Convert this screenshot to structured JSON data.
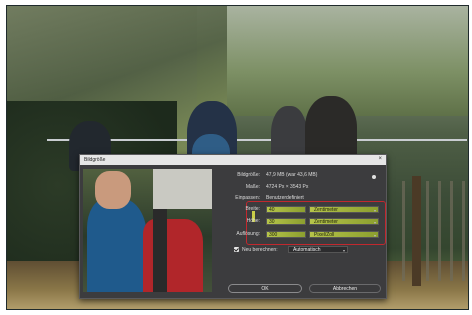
{
  "dialog": {
    "title": "Bildgröße",
    "close_glyph": "×",
    "info_rows": [
      {
        "label": "Bildgröße:",
        "value": "47,9 MB (war 43,6 MB)"
      },
      {
        "label": "Maße:",
        "value": "4724 Px × 3543 Px"
      },
      {
        "label": "Einpassen:",
        "value": "Benutzerdefiniert"
      }
    ],
    "fields": [
      {
        "label": "Breite:",
        "value": "40",
        "unit": "Zentimeter"
      },
      {
        "label": "Höhe:",
        "value": "30",
        "unit": "Zentimeter"
      },
      {
        "label": "Auflösung:",
        "value": "300",
        "unit": "Pixel/Zoll"
      }
    ],
    "resample": {
      "label": "Neu berechnen:",
      "value": "Automatisch",
      "checked": true
    },
    "ok_label": "OK",
    "cancel_label": "Abbrechen"
  },
  "colors": {
    "highlight": "#b6c44a",
    "annotation": "#c1282e",
    "dialog_bg": "#3c3c3e"
  }
}
